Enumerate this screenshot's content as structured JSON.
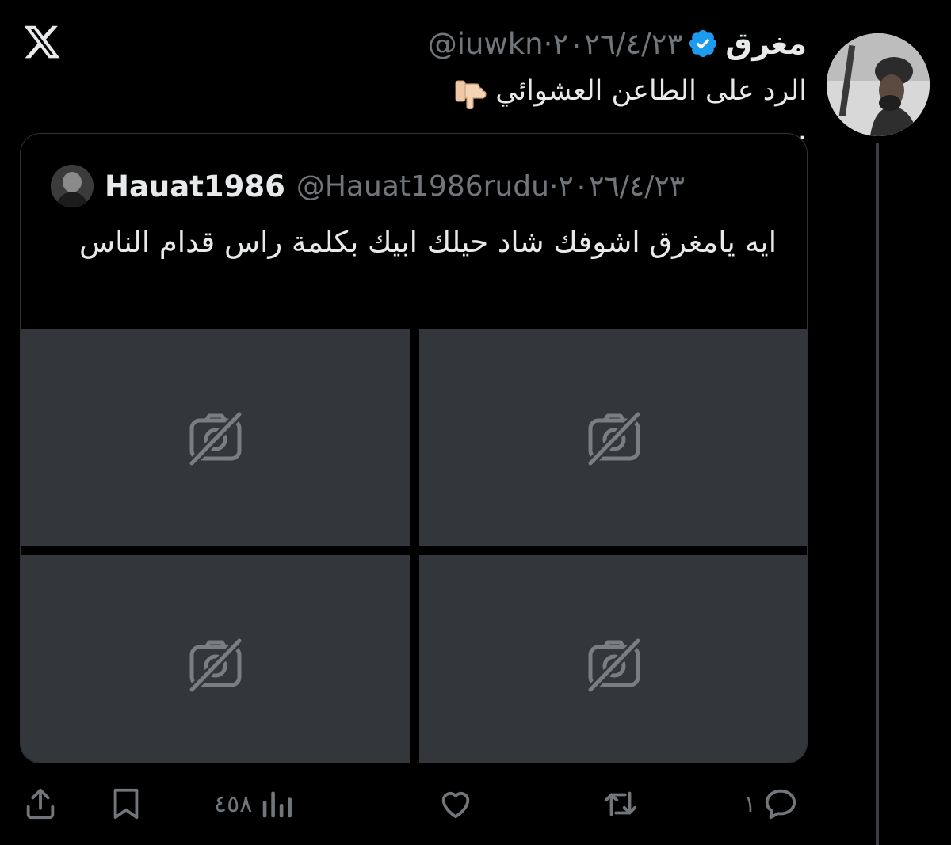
{
  "app": {
    "logo": "x-logo"
  },
  "tweet": {
    "display_name": "مغرق",
    "handle": "@iuwkn",
    "date": "٢٠٢٦/٤/٢٣",
    "separator": "·",
    "text_main": "الرد على الطاعن العشوائي",
    "text_suffix": ".",
    "emoji_icon": "backhand-index-pointing-down-icon",
    "verified_color": "#1d9bf0"
  },
  "quote": {
    "display_name": "Hauat1986",
    "handle": "@Hauat1986rudu",
    "date": "٢٠٢٦/٤/٢٣",
    "separator": "·",
    "text": "ايه يامغرق اشوفك شاد حيلك ابيك بكلمة راس قدام الناس",
    "media": [
      {
        "icon": "image-unavailable-icon"
      },
      {
        "icon": "image-unavailable-icon"
      },
      {
        "icon": "image-unavailable-icon"
      },
      {
        "icon": "image-unavailable-icon"
      }
    ]
  },
  "actions": {
    "reply_count": "١",
    "retweet_count": "",
    "like_count": "",
    "views_count": "٤٥٨",
    "icons": [
      "reply-icon",
      "retweet-icon",
      "like-icon",
      "views-icon",
      "bookmark-icon",
      "share-icon"
    ]
  }
}
